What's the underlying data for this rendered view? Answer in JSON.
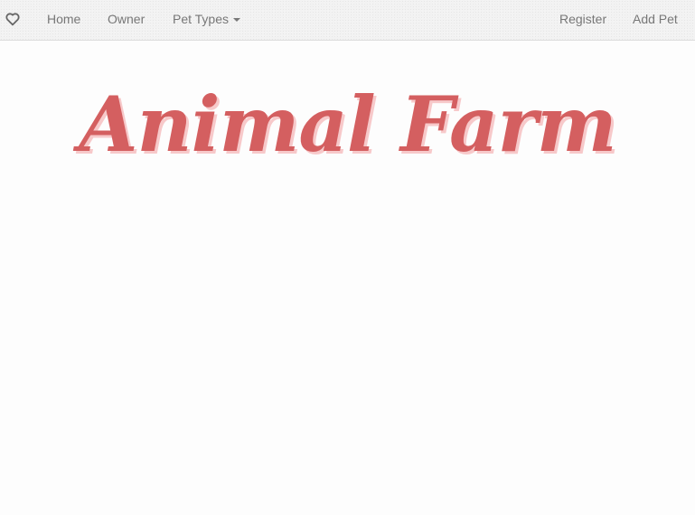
{
  "navbar": {
    "brand_icon": "heart-outline-icon",
    "links": [
      {
        "label": "Home"
      },
      {
        "label": "Owner"
      },
      {
        "label": "Pet Types",
        "has_dropdown": true
      }
    ],
    "right_links": [
      {
        "label": "Register"
      },
      {
        "label": "Add Pet"
      }
    ]
  },
  "hero": {
    "title": "Animal Farm"
  },
  "colors": {
    "title": "#d45f60",
    "title_shadow": "#f7c9ca",
    "nav_text": "#777777",
    "nav_background": "#f2f2f2",
    "page_background": "#fdfdfd"
  }
}
